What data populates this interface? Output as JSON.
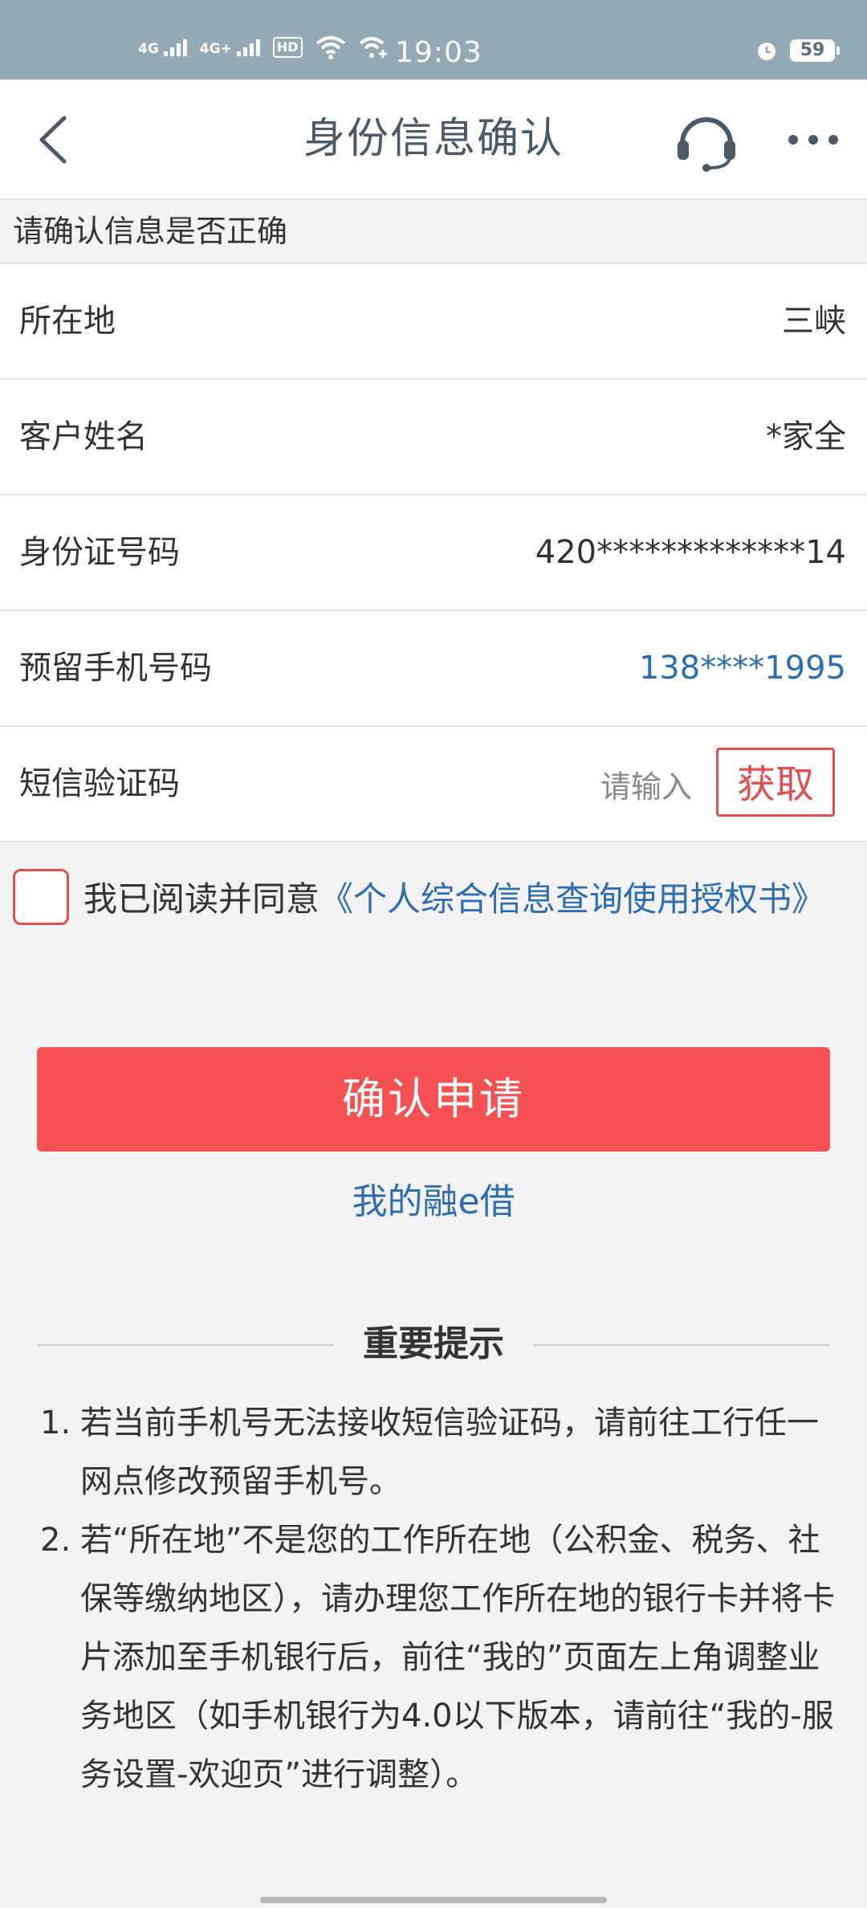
{
  "status_bar": {
    "signal1_label": "4G",
    "signal2_label": "4G+",
    "hd_label": "HD",
    "time": "19:03",
    "battery": "59"
  },
  "header": {
    "title": "身份信息确认"
  },
  "notice": "请确认信息是否正确",
  "form": {
    "location": {
      "label": "所在地",
      "value": "三峡"
    },
    "name": {
      "label": "客户姓名",
      "value": "*家全"
    },
    "id_number": {
      "label": "身份证号码",
      "value": "420*************14"
    },
    "phone": {
      "label": "预留手机号码",
      "value": "138****1995"
    },
    "sms": {
      "label": "短信验证码",
      "placeholder": "请输入",
      "get_button": "获取"
    }
  },
  "agreement": {
    "text": "我已阅读并同意",
    "link": "《个人综合信息查询使用授权书》"
  },
  "confirm_button": "确认申请",
  "my_loan_link": "我的融e借",
  "tips": {
    "title": "重要提示",
    "items": [
      {
        "num": "1.",
        "text": "若当前手机号无法接收短信验证码，请前往工行任一网点修改预留手机号。"
      },
      {
        "num": "2.",
        "text": "若“所在地”不是您的工作所在地（公积金、税务、社保等缴纳地区），请办理您工作所在地的银行卡并将卡片添加至手机银行后，前往“我的”页面左上角调整业务地区（如手机银行为4.0以下版本，请前往“我的-服务设置-欢迎页”进行调整）。"
      }
    ]
  },
  "colors": {
    "accent_red": "#f75253",
    "link_blue": "#2f6db3",
    "status_bar": "#93a9b5"
  }
}
